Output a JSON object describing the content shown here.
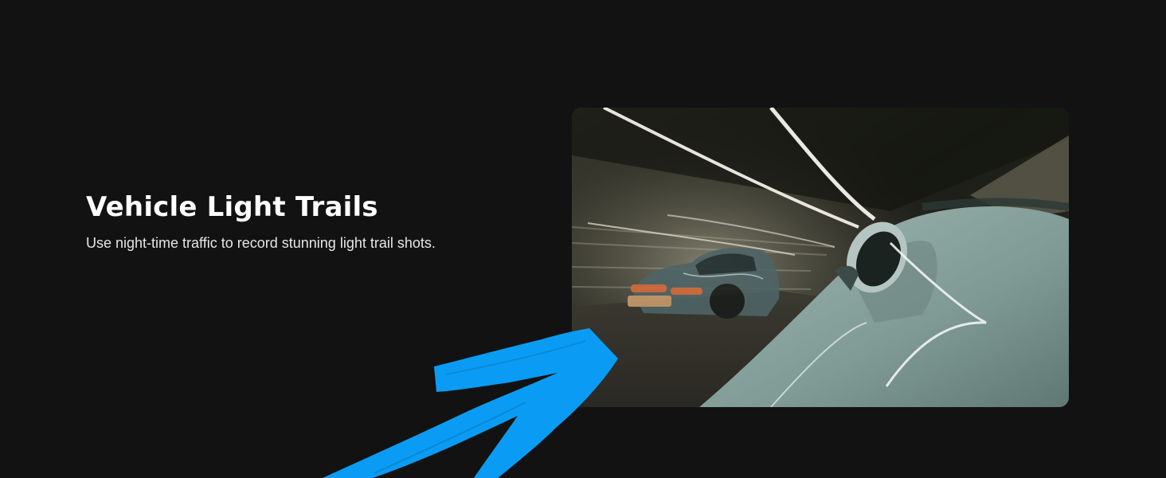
{
  "section": {
    "title": "Vehicle Light Trails",
    "description": "Use night-time traffic to record stunning light trail shots."
  },
  "colors": {
    "background": "#121212",
    "title": "#ffffff",
    "description": "#e6e6e6",
    "arrow": "#0a9cf4",
    "car": "#8faaa5"
  },
  "icons": {
    "arrow": "hand-drawn-arrow-icon"
  }
}
